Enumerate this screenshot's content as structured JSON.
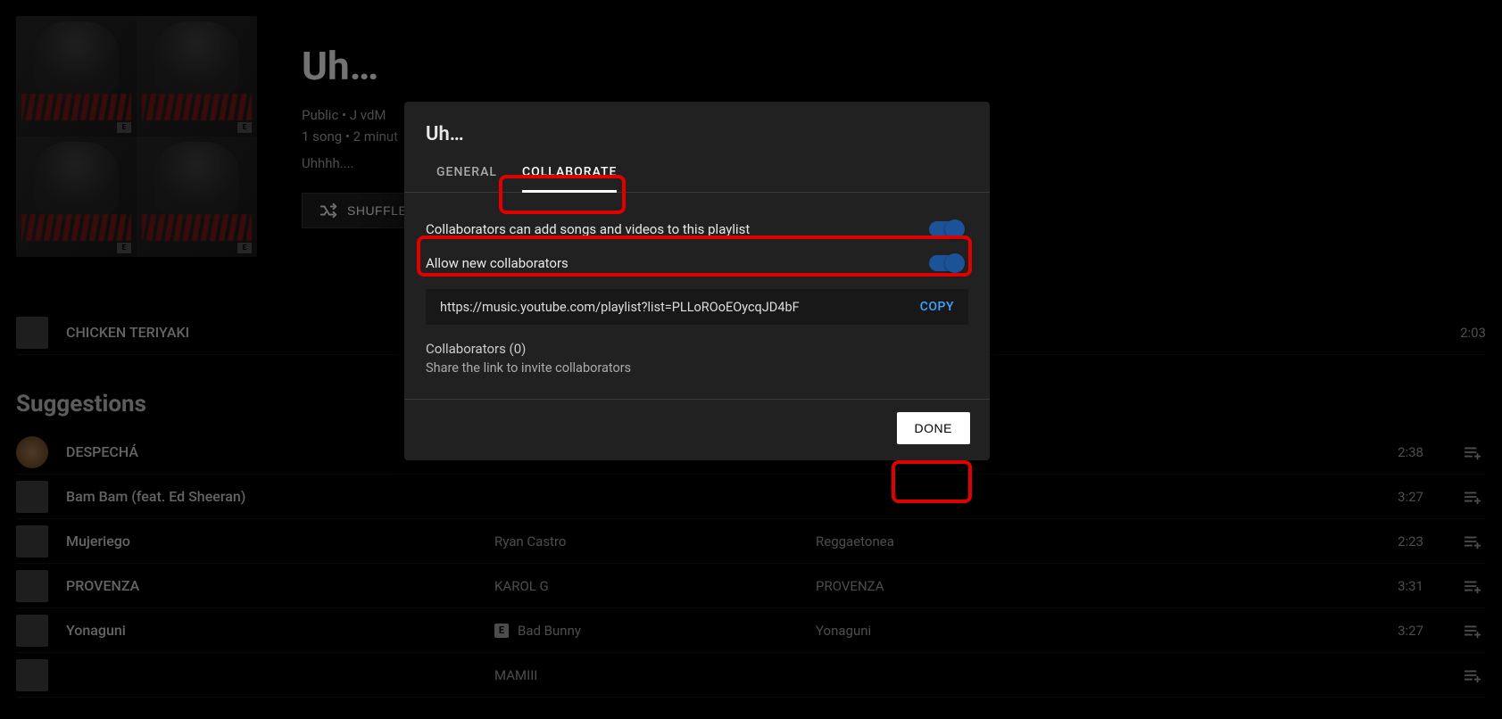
{
  "playlist": {
    "title": "Uh…",
    "meta_line1": "Public • J vdM",
    "meta_line2": "1 song • 2 minut",
    "description": "Uhhhh....",
    "shuffle_label": "SHUFFLE"
  },
  "main_track": {
    "title": "CHICKEN TERIYAKI",
    "duration": "2:03"
  },
  "suggestions_heading": "Suggestions",
  "suggestions": [
    {
      "title": "DESPECHÁ",
      "artist": "",
      "album": "",
      "duration": "2:38",
      "explicit": false
    },
    {
      "title": "Bam Bam (feat. Ed Sheeran)",
      "artist": "",
      "album": "",
      "duration": "3:27",
      "explicit": false
    },
    {
      "title": "Mujeriego",
      "artist": "Ryan Castro",
      "album": "Reggaetonea",
      "duration": "2:23",
      "explicit": false
    },
    {
      "title": "PROVENZA",
      "artist": "KAROL G",
      "album": "PROVENZA",
      "duration": "3:31",
      "explicit": false
    },
    {
      "title": "Yonaguni",
      "artist": "Bad Bunny",
      "album": "Yonaguni",
      "duration": "3:27",
      "explicit": true
    },
    {
      "title": "",
      "artist": "MAMIII",
      "album": "",
      "duration": "",
      "explicit": false
    }
  ],
  "modal": {
    "title": "Uh…",
    "tab_general": "GENERAL",
    "tab_collaborate": "COLLABORATE",
    "row1_label": "Collaborators can add songs and videos to this playlist",
    "row2_label": "Allow new collaborators",
    "share_url": "https://music.youtube.com/playlist?list=PLLoROoEOycqJD4bF",
    "copy_label": "COPY",
    "collaborators_label": "Collaborators (0)",
    "collaborators_hint": "Share the link to invite collaborators",
    "done_label": "DONE"
  }
}
